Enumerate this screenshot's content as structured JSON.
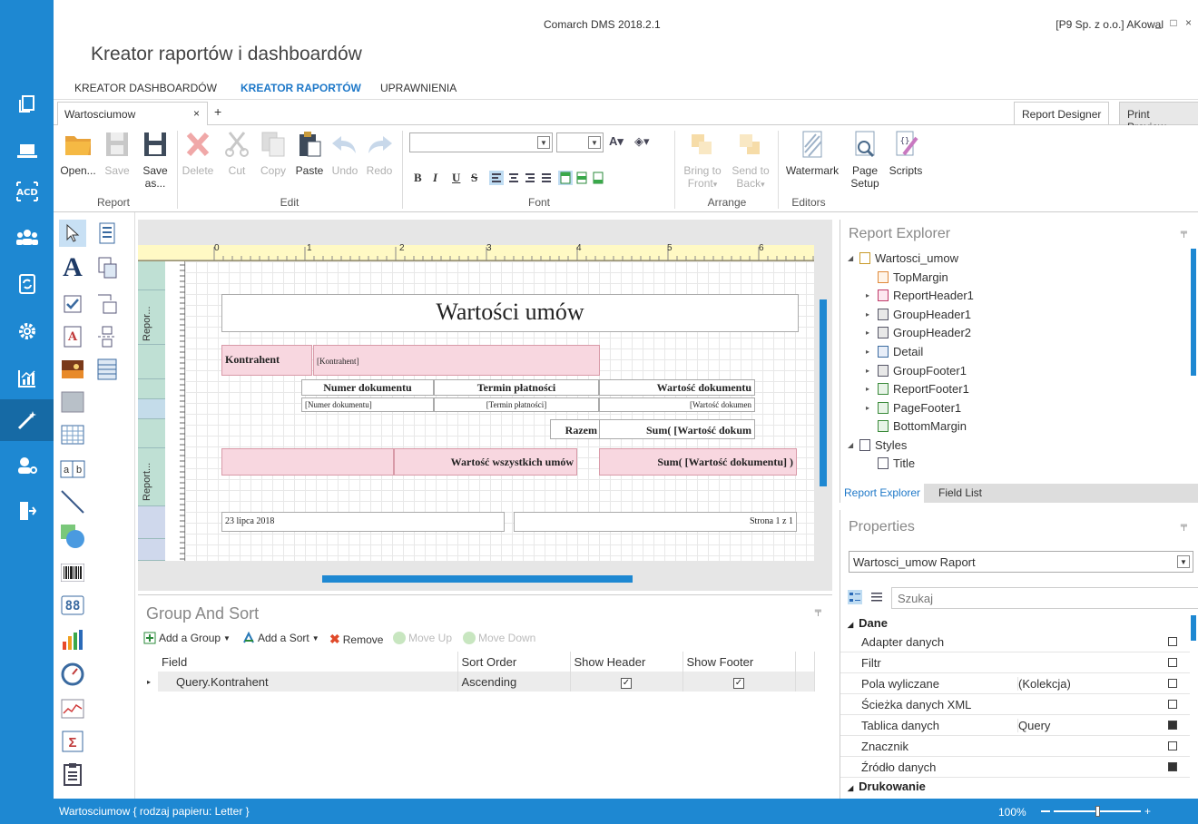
{
  "app": {
    "window_title": "Comarch DMS 2018.2.1",
    "user": "[P9 Sp. z o.o.]  AKowal",
    "window_controls": "_ □ ×",
    "page_title": "Kreator raportów i dashboardów"
  },
  "menu": [
    "KREATOR DASHBOARDÓW",
    "KREATOR RAPORTÓW",
    "UPRAWNIENIA"
  ],
  "tabs": {
    "doc": "Wartosciumow",
    "close": "×",
    "add": "+",
    "report_designer": "Report Designer",
    "print_preview": "Print Preview"
  },
  "ribbon": {
    "open": "Open...",
    "save": "Save",
    "save_as": "Save as...",
    "delete": "Delete",
    "cut": "Cut",
    "copy": "Copy",
    "paste": "Paste",
    "undo": "Undo",
    "redo": "Redo",
    "bring_front": "Bring to Front",
    "send_back": "Send to Back",
    "watermark": "Watermark",
    "page_setup": "Page Setup",
    "scripts": "Scripts",
    "groups": {
      "report": "Report",
      "edit": "Edit",
      "font": "Font",
      "arrange": "Arrange",
      "editors": "Editors"
    },
    "font_buttons": [
      "B",
      "I",
      "U",
      "S"
    ]
  },
  "designer": {
    "ruler": [
      "0",
      "1",
      "2",
      "3",
      "4",
      "5",
      "6"
    ],
    "band_labels": [
      "Repor...",
      "Report..."
    ],
    "title": "Wartości umów",
    "kontrahent_label": "Kontrahent",
    "kontrahent_field": "[Kontrahent]",
    "col1_header": "Numer dokumentu",
    "col2_header": "Termin płatności",
    "col3_header": "Wartość dokumentu",
    "col1_field": "[Numer dokumentu]",
    "col2_field": "[Termin płatności]",
    "col3_field": "[Wartość dokumen",
    "razem": "Razem",
    "sum1": "Sum( [Wartość dokum",
    "all_contracts": "Wartość wszystkich umów",
    "sum2": "Sum( [Wartość dokumentu] )",
    "date": "23 lipca 2018",
    "page": "Strona 1 z 1"
  },
  "group_sort": {
    "title": "Group And Sort",
    "pin": "📌",
    "add_group": "Add a Group",
    "add_sort": "Add a Sort",
    "remove": "Remove",
    "move_up": "Move Up",
    "move_down": "Move Down",
    "columns": [
      "Field",
      "Sort Order",
      "Show Header",
      "Show Footer"
    ],
    "row": {
      "field": "Query.Kontrahent",
      "order": "Ascending",
      "header": "✓",
      "footer": "✓"
    }
  },
  "report_explorer": {
    "title": "Report Explorer",
    "items": [
      "Wartosci_umow",
      "TopMargin",
      "ReportHeader1",
      "GroupHeader1",
      "GroupHeader2",
      "Detail",
      "GroupFooter1",
      "ReportFooter1",
      "PageFooter1",
      "BottomMargin",
      "Styles",
      "Title"
    ],
    "tab_explorer": "Report Explorer",
    "tab_fields": "Field List"
  },
  "properties": {
    "title": "Properties",
    "selector": "Wartosci_umow  Raport",
    "search_placeholder": "Szukaj",
    "section_data": "Dane",
    "section_print": "Drukowanie",
    "rows": [
      {
        "name": "Adapter danych",
        "value": ""
      },
      {
        "name": "Filtr",
        "value": ""
      },
      {
        "name": "Pola wyliczane",
        "value": "(Kolekcja)"
      },
      {
        "name": "Ścieżka danych XML",
        "value": ""
      },
      {
        "name": "Tablica danych",
        "value": "Query"
      },
      {
        "name": "Znacznik",
        "value": ""
      },
      {
        "name": "Źródło danych",
        "value": ""
      }
    ]
  },
  "status": {
    "text": "Wartosciumow { rodzaj papieru: Letter }",
    "zoom": "100%",
    "zoom_level_percent": 50
  },
  "colors": {
    "accent": "#1e88d2",
    "band": "#bfe0d4",
    "pink": "#f8d7e0"
  }
}
